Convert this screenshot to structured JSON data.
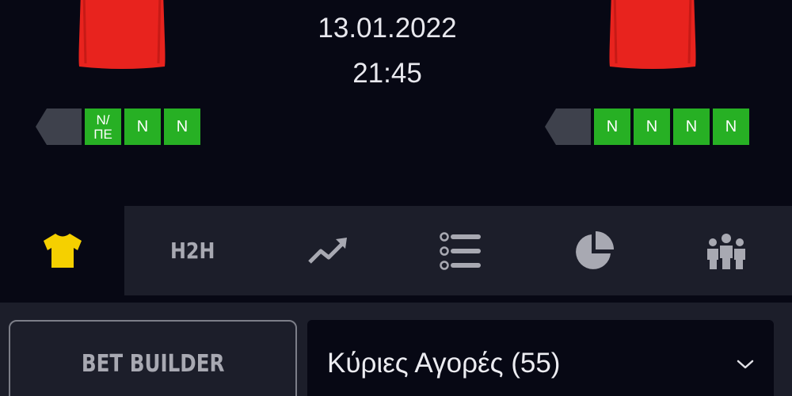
{
  "match": {
    "date": "13.01.2022",
    "time": "21:45"
  },
  "home_team": {
    "jersey_color": "#e8231e",
    "form": [
      "N/\nΠΕ",
      "N",
      "N"
    ]
  },
  "away_team": {
    "jersey_color": "#e8231e",
    "form": [
      "N",
      "N",
      "N",
      "N"
    ]
  },
  "colors": {
    "background": "#070814",
    "panel": "#1c1e2a",
    "form_win": "#27b024",
    "active_tab_icon": "#f5d000",
    "inactive_tab": "#a8a9b2"
  },
  "tabs": [
    {
      "icon": "jersey-icon",
      "active": true
    },
    {
      "label": "H2H",
      "active": false
    },
    {
      "icon": "trend-chart-icon",
      "active": false
    },
    {
      "icon": "list-icon",
      "active": false
    },
    {
      "icon": "pie-chart-icon",
      "active": false
    },
    {
      "icon": "players-icon",
      "active": false
    }
  ],
  "bet_builder": {
    "label": "BET BUILDER"
  },
  "markets": {
    "label": "Κύριες Αγορές (55)",
    "icon": "chevron-down-icon"
  }
}
